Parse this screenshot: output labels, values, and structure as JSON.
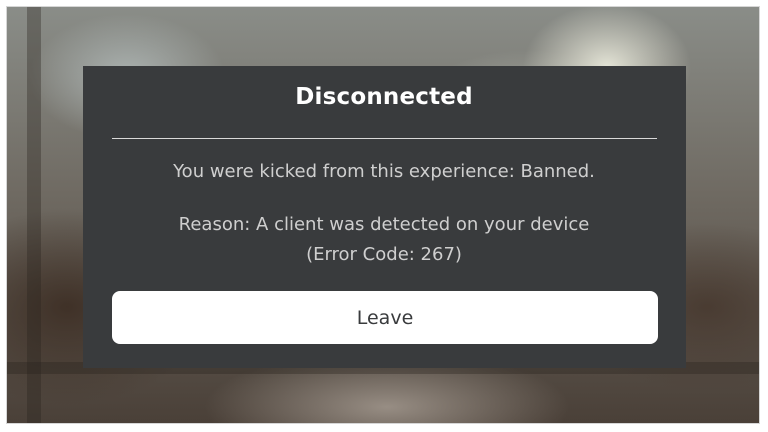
{
  "dialog": {
    "title": "Disconnected",
    "kick_message": "You were kicked from this experience: Banned.",
    "reason": "Reason: A client was detected on your device",
    "error_code": "(Error Code: 267)",
    "leave_label": "Leave"
  },
  "colors": {
    "dialog_bg": "#393b3d",
    "title": "#ffffff",
    "body_text": "#cfcfcf",
    "button_bg": "#ffffff",
    "button_text": "#393b3d"
  }
}
